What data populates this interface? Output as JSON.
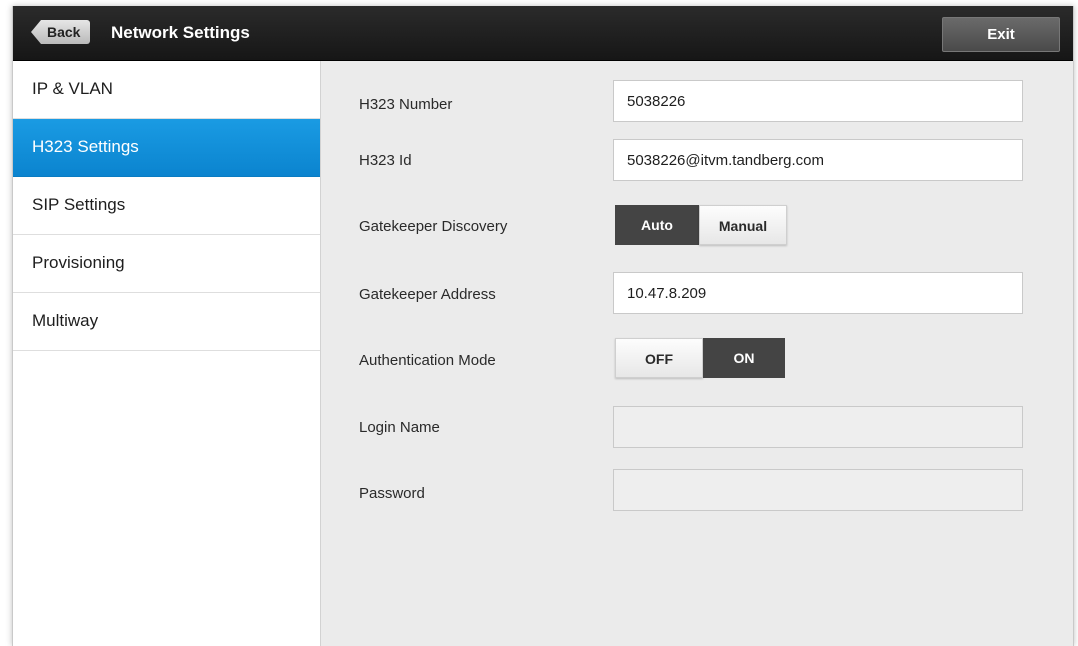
{
  "header": {
    "back_label": "Back",
    "title": "Network Settings",
    "exit_label": "Exit"
  },
  "sidebar": {
    "items": [
      {
        "label": "IP & VLAN",
        "active": false
      },
      {
        "label": "H323 Settings",
        "active": true
      },
      {
        "label": "SIP Settings",
        "active": false
      },
      {
        "label": "Provisioning",
        "active": false
      },
      {
        "label": "Multiway",
        "active": false
      }
    ]
  },
  "form": {
    "h323_number": {
      "label": "H323 Number",
      "value": "5038226"
    },
    "h323_id": {
      "label": "H323 Id",
      "value": "5038226@itvm.tandberg.com"
    },
    "gatekeeper_discovery": {
      "label": "Gatekeeper Discovery",
      "options": [
        "Auto",
        "Manual"
      ],
      "selected": "Auto"
    },
    "gatekeeper_address": {
      "label": "Gatekeeper Address",
      "value": "10.47.8.209"
    },
    "authentication_mode": {
      "label": "Authentication Mode",
      "options": [
        "OFF",
        "ON"
      ],
      "selected": "ON"
    },
    "login_name": {
      "label": "Login Name",
      "value": ""
    },
    "password": {
      "label": "Password",
      "value": ""
    }
  },
  "colors": {
    "accent": "#0b84cf",
    "titlebar": "#1f1f1f",
    "selected_segment": "#444444"
  }
}
